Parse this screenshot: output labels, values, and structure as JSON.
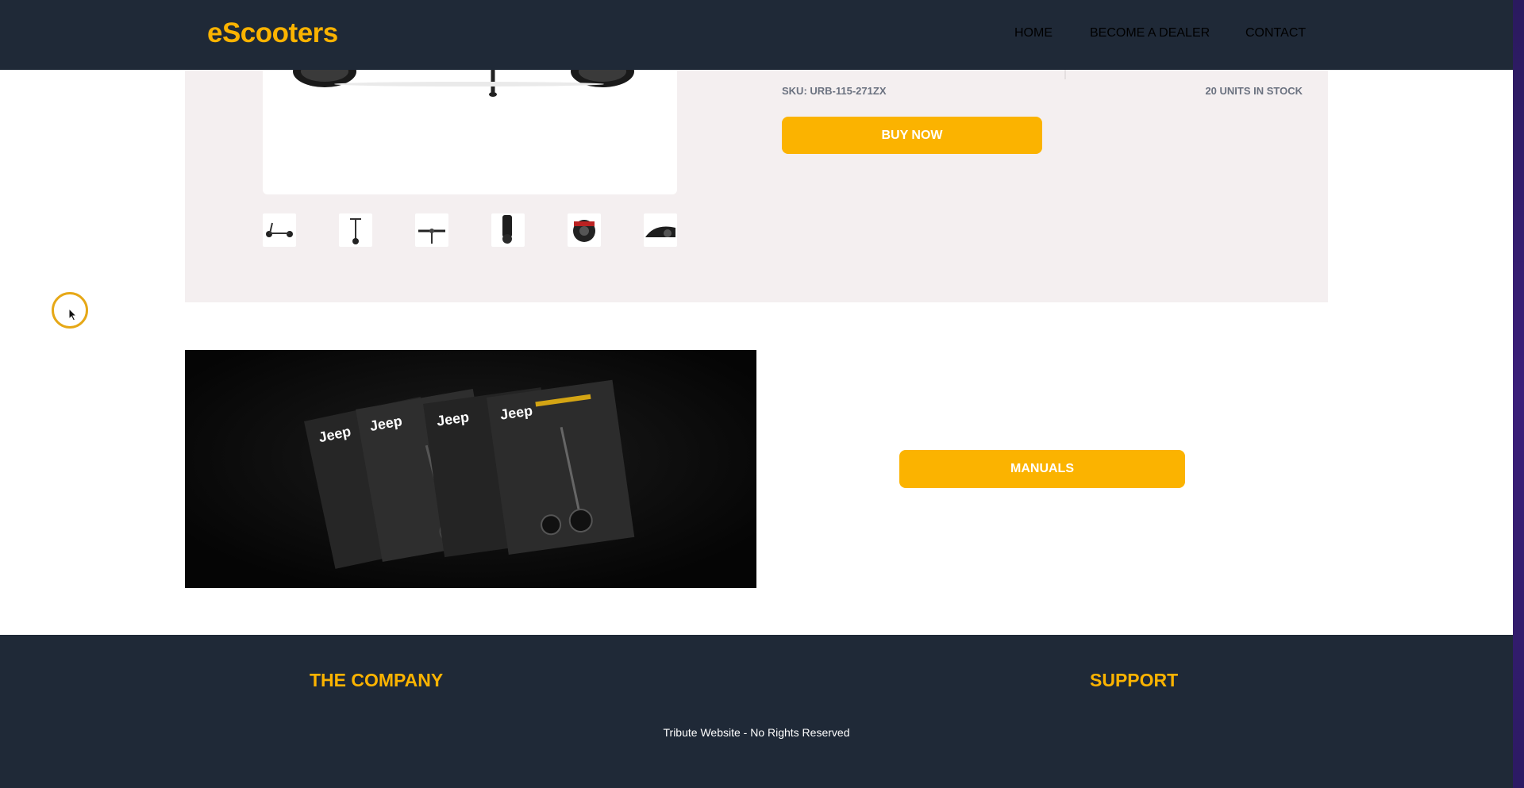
{
  "header": {
    "logo": "eScooters",
    "nav": [
      {
        "label": "HOME"
      },
      {
        "label": "BECOME A DEALER"
      },
      {
        "label": "CONTACT"
      }
    ]
  },
  "product": {
    "sku": "SKU: URB-115-271ZX",
    "stock": "20 UNITS IN STOCK",
    "buy_label": "BUY NOW",
    "thumbnails": 6
  },
  "manuals": {
    "image_brand": "Jeep",
    "button_label": "MANUALS"
  },
  "footer": {
    "company_heading": "THE COMPANY",
    "support_heading": "SUPPORT",
    "note": "Tribute Website - No Rights Reserved"
  },
  "colors": {
    "accent": "#fbb300",
    "header_bg": "#1f2937",
    "panel_bg": "#f4eff0"
  }
}
